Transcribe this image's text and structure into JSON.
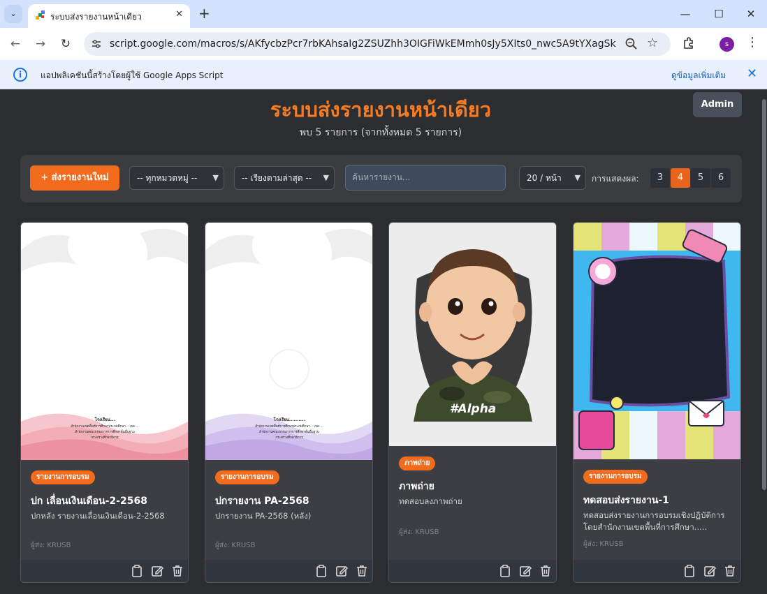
{
  "browser": {
    "tab_title": "ระบบส่งรายงานหน้าเดียว",
    "url": "script.google.com/macros/s/AKfycbzPcr7rbKAhsaIg2ZSUZhh3OIGFiWkEMmh0sJy5XIts0_nwc5A9tYXagSkhiGP5NC8x...",
    "profile_initial": "s",
    "infobar_text": "แอปพลิเคชันนี้สร้างโดยผู้ใช้ Google Apps Script",
    "infobar_link": "ดูข้อมูลเพิ่มเติม"
  },
  "header": {
    "title": "ระบบส่งรายงานหน้าเดียว",
    "subtitle": "พบ 5 รายการ (จากทั้งหมด 5 รายการ)",
    "admin_label": "Admin"
  },
  "controls": {
    "new_report_label": "+ ส่งรายงานใหม่",
    "category_selected": "-- ทุกหมวดหมู่ --",
    "sort_selected": "-- เรียงตามล่าสุด --",
    "search_placeholder": "ค้นหารายงาน...",
    "per_page_selected": "20 / หน้า",
    "display_label": "การแสดงผล:",
    "columns": [
      "3",
      "4",
      "5",
      "6"
    ],
    "active_column": "4"
  },
  "cards": [
    {
      "badge": "รายงานการอบรม",
      "title": "ปก เลื่อนเงินเดือน-2-2568",
      "desc": "ปกหลัง รายงานเลื่อนเงินเดือน-2-2568",
      "sender": "ผู้ส่ง: KRUSB",
      "thumb_lines": [
        "โรงเรียน...",
        "สำนักงานเขตพื้นที่การศึกษาประถมศึกษา... เขต ...",
        "สำนักงานคณะกรรมการการศึกษาขั้นพื้นฐาน",
        "กระทรวงศึกษาธิการ"
      ]
    },
    {
      "badge": "รายงานการอบรม",
      "title": "ปกรายงาน PA-2568",
      "desc": "ปกรายงาน PA-2568 (หลัง)",
      "sender": "ผู้ส่ง: KRUSB",
      "thumb_lines": [
        "โรงเรียน..........",
        "สำนักงานเขตพื้นที่การศึกษาประถมศึกษา... เขต ...",
        "สำนักงานคณะกรรมการการศึกษาขั้นพื้นฐาน",
        "กระทรวงศึกษาธิการ"
      ]
    },
    {
      "badge": "ภาพถ่าย",
      "title": "ภาพถ่าย",
      "desc": "ทดสอบลงภาพถ่าย",
      "sender": "ผู้ส่ง: KRUSB",
      "shirt_text": "#Alpha"
    },
    {
      "badge": "รายงานการอบรม",
      "title": "ทดสอบส่งรายงาน-1",
      "desc": "ทดสอบส่งรายงานการอบรมเชิงปฏิบัติการ โดยสำนักงานเขตพื้นที่การศึกษา.....",
      "sender": "ผู้ส่ง: KRUSB"
    }
  ]
}
